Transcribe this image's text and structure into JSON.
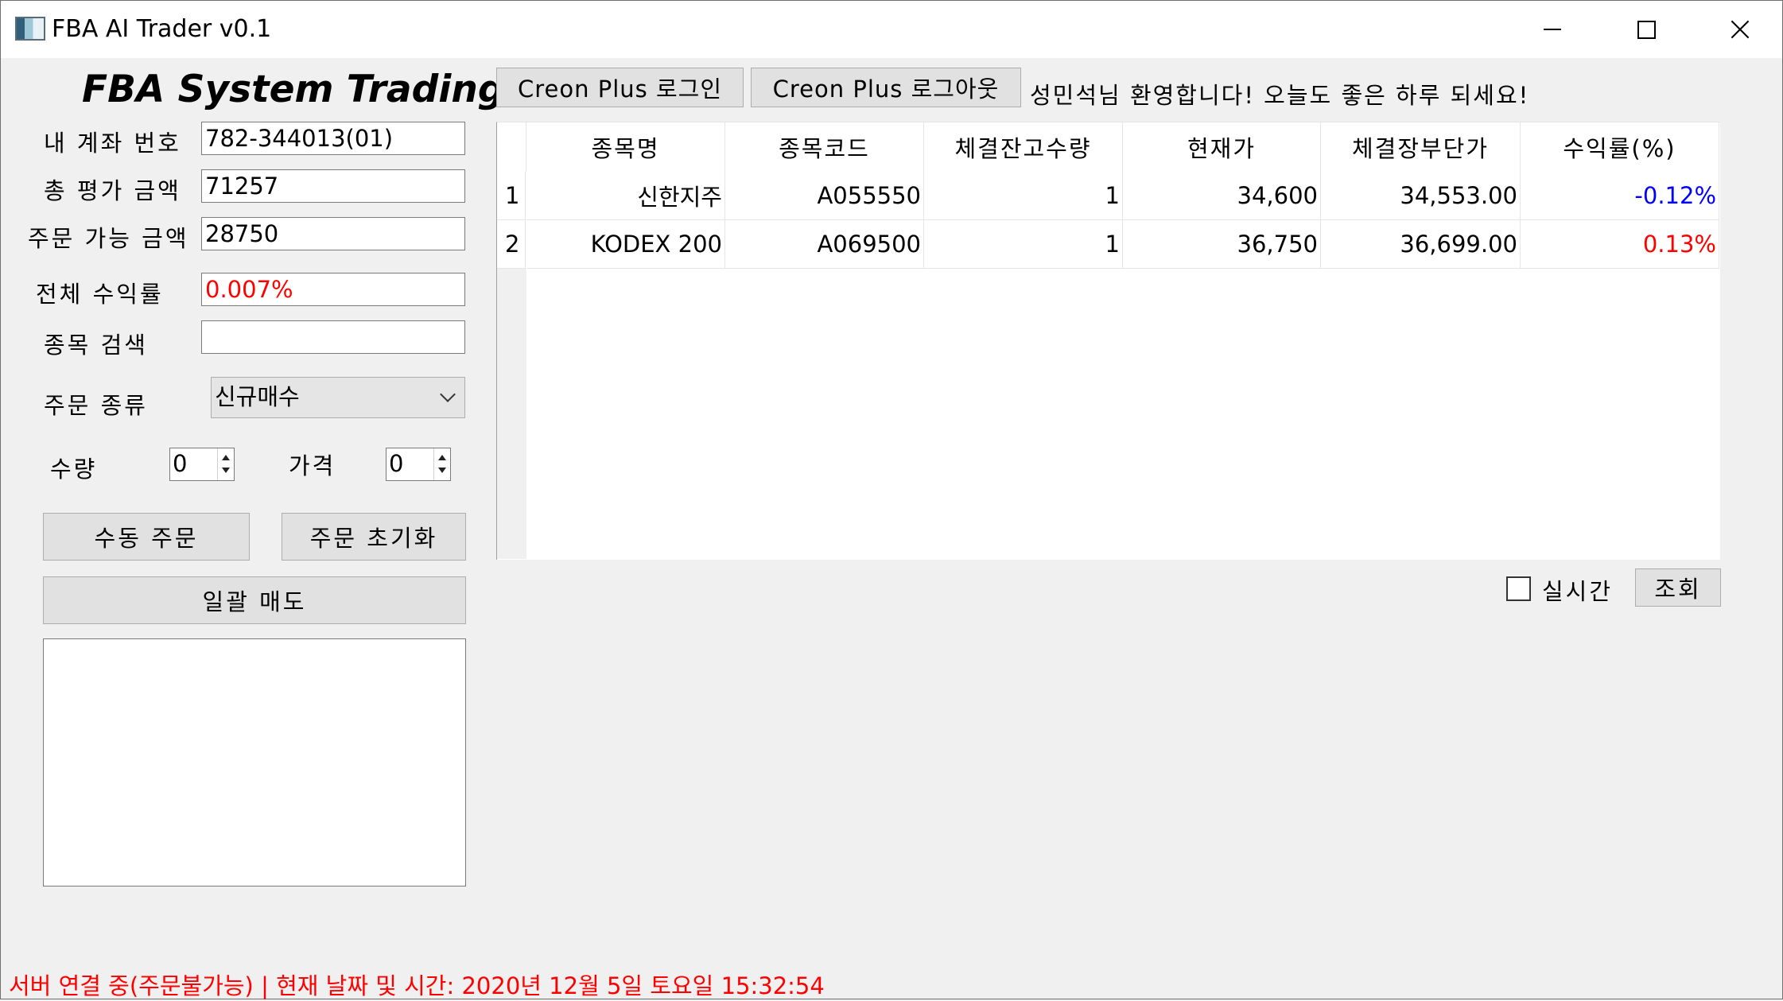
{
  "window": {
    "title": "FBA AI Trader v0.1"
  },
  "brand": "FBA System Trading",
  "account": {
    "account_number_label": "내 계좌 번호",
    "account_number": "782-344013(01)",
    "total_eval_label": "총 평가 금액",
    "total_eval": "71257",
    "orderable_label": "주문 가능 금액",
    "orderable": "28750",
    "total_return_label": "전체 수익률",
    "total_return": "0.007%",
    "stock_search_label": "종목 검색",
    "stock_search_value": ""
  },
  "order": {
    "type_label": "주문 종류",
    "type_selected": "신규매수",
    "qty_label": "수량",
    "qty_value": "0",
    "price_label": "가격",
    "price_value": "0",
    "manual_order_button": "수동 주문",
    "reset_order_button": "주문 초기화",
    "sell_all_button": "일괄 매도"
  },
  "login": {
    "login_button": "Creon Plus 로그인",
    "logout_button": "Creon Plus 로그아웃",
    "welcome_message": "성민석님 환영합니다! 오늘도 좋은 하루 되세요!"
  },
  "table": {
    "columns": [
      "종목명",
      "종목코드",
      "체결잔고수량",
      "현재가",
      "체결장부단가",
      "수익률(%)"
    ],
    "rows": [
      {
        "index": "1",
        "name": "신한지주",
        "code": "A055550",
        "qty": "1",
        "price": "34,600",
        "avg_price": "34,553.00",
        "return": "-0.12%",
        "return_sign": "neg"
      },
      {
        "index": "2",
        "name": "KODEX 200",
        "code": "A069500",
        "qty": "1",
        "price": "36,750",
        "avg_price": "36,699.00",
        "return": "0.13%",
        "return_sign": "pos"
      }
    ]
  },
  "controls": {
    "realtime_label": "실시간",
    "realtime_checked": false,
    "query_button": "조회"
  },
  "status_bar": "서버 연결 중(주문불가능) | 현재 날짜 및 시간: 2020년 12월 5일 토요일 15:32:54",
  "colors": {
    "negative": "#0000ff",
    "positive": "#ff0000",
    "status": "#ff0000"
  }
}
